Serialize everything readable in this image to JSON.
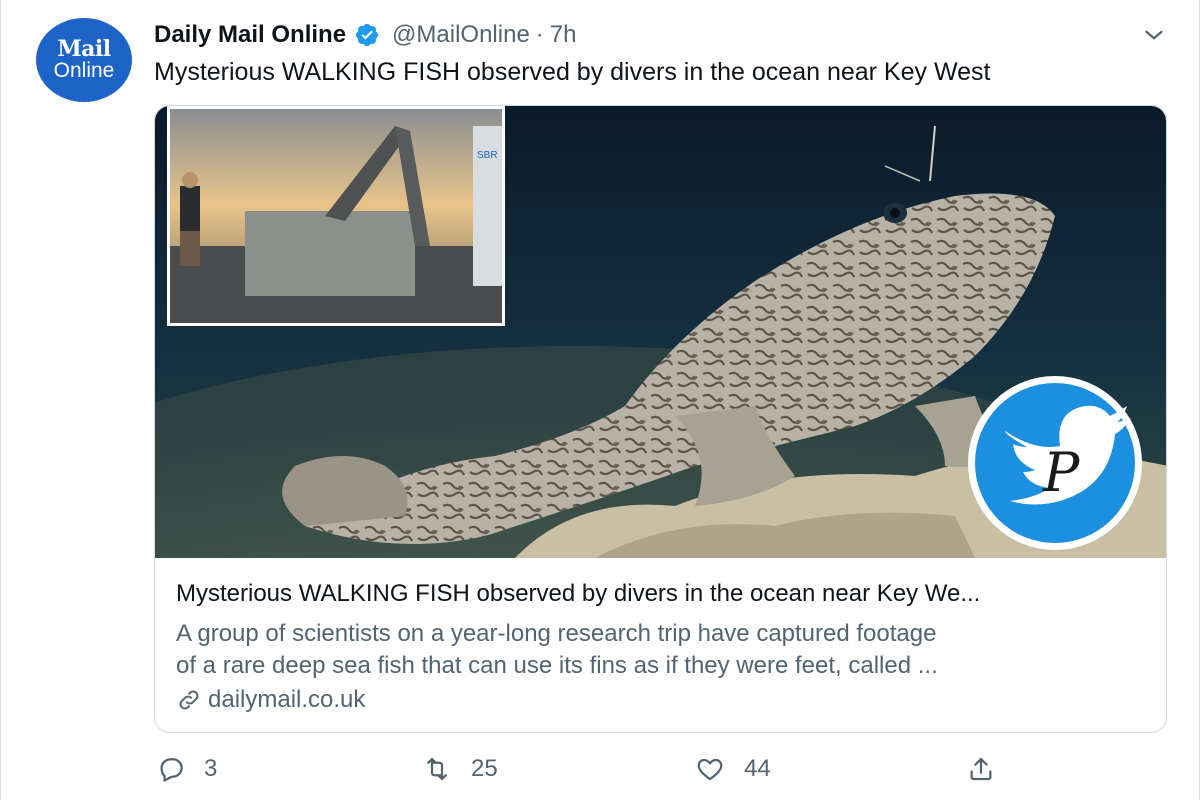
{
  "account": {
    "avatar_line1": "Mail",
    "avatar_line2": "Online",
    "display_name": "Daily Mail Online",
    "handle": "@MailOnline",
    "separator": "·",
    "time": "7h"
  },
  "tweet": {
    "text": "Mysterious WALKING FISH observed by divers in the ocean near Key West"
  },
  "card": {
    "title": "Mysterious WALKING FISH observed by divers in the ocean near Key We...",
    "description_line1": "A group of scientists on a year-long research trip have captured footage",
    "description_line2": "of a rare deep sea fish that can use its fins as if they were feet, called ...",
    "domain": "dailymail.co.uk",
    "image_inset_label": "SBR",
    "watermark_letter": "P"
  },
  "actions": {
    "reply_count": "3",
    "retweet_count": "25",
    "like_count": "44"
  },
  "colors": {
    "text_primary": "#0f1419",
    "text_secondary": "#536471",
    "verified": "#1d9bf0",
    "avatar_bg": "#1d63c8",
    "card_border": "#cfd9de"
  },
  "icons": {
    "verified": "verified-badge-icon",
    "caret": "chevron-down-icon",
    "link": "link-icon",
    "reply": "reply-icon",
    "retweet": "retweet-icon",
    "like": "heart-icon",
    "share": "share-icon"
  }
}
